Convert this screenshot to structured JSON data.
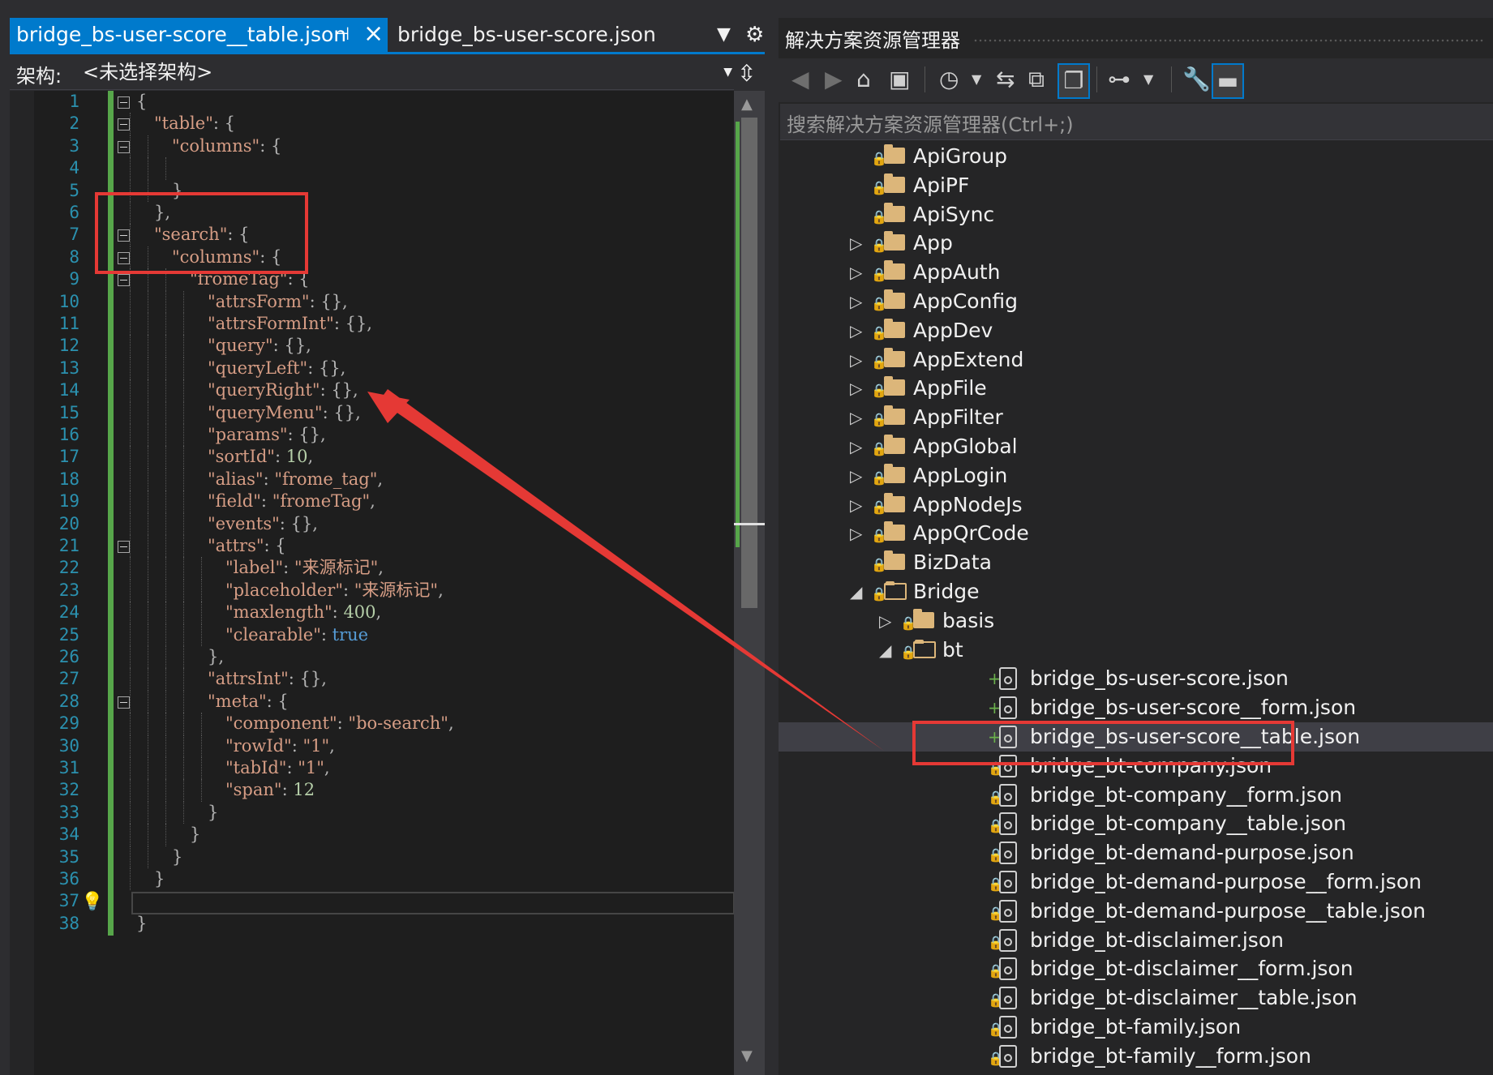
{
  "editor": {
    "tabs": [
      {
        "label": "bridge_bs-user-score__table.json",
        "active": true
      },
      {
        "label": "bridge_bs-user-score.json",
        "active": false
      }
    ],
    "schema_label": "架构:",
    "schema_value": "<未选择架构>",
    "lines": [
      {
        "n": "1",
        "html": "<span class='p'>{</span>"
      },
      {
        "n": "2",
        "html": "<span class='k'>\"table\"</span><span class='p'>: {</span>"
      },
      {
        "n": "3",
        "html": "<span class='k'>\"columns\"</span><span class='p'>: {</span>"
      },
      {
        "n": "4",
        "html": ""
      },
      {
        "n": "5",
        "html": "<span class='p'>}</span>"
      },
      {
        "n": "6",
        "html": "<span class='p'>},</span>"
      },
      {
        "n": "7",
        "html": "<span class='k'>\"search\"</span><span class='p'>: {</span>"
      },
      {
        "n": "8",
        "html": "<span class='k'>\"columns\"</span><span class='p'>: {</span>"
      },
      {
        "n": "9",
        "html": "<span class='k'>\"fromeTag\"</span><span class='p'>: {</span>"
      },
      {
        "n": "10",
        "html": "<span class='k'>\"attrsForm\"</span><span class='p'>: {},</span>"
      },
      {
        "n": "11",
        "html": "<span class='k'>\"attrsFormInt\"</span><span class='p'>: {},</span>"
      },
      {
        "n": "12",
        "html": "<span class='k'>\"query\"</span><span class='p'>: {},</span>"
      },
      {
        "n": "13",
        "html": "<span class='k'>\"queryLeft\"</span><span class='p'>: {},</span>"
      },
      {
        "n": "14",
        "html": "<span class='k'>\"queryRight\"</span><span class='p'>: {},</span>"
      },
      {
        "n": "15",
        "html": "<span class='k'>\"queryMenu\"</span><span class='p'>: {},</span>"
      },
      {
        "n": "16",
        "html": "<span class='k'>\"params\"</span><span class='p'>: {},</span>"
      },
      {
        "n": "17",
        "html": "<span class='k'>\"sortId\"</span><span class='p'>: </span><span class='n'>10</span><span class='p'>,</span>"
      },
      {
        "n": "18",
        "html": "<span class='k'>\"alias\"</span><span class='p'>: </span><span class='s'>\"frome_tag\"</span><span class='p'>,</span>"
      },
      {
        "n": "19",
        "html": "<span class='k'>\"field\"</span><span class='p'>: </span><span class='s'>\"fromeTag\"</span><span class='p'>,</span>"
      },
      {
        "n": "20",
        "html": "<span class='k'>\"events\"</span><span class='p'>: {},</span>"
      },
      {
        "n": "21",
        "html": "<span class='k'>\"attrs\"</span><span class='p'>: {</span>"
      },
      {
        "n": "22",
        "html": "<span class='k'>\"label\"</span><span class='p'>: </span><span class='s'>\"来源标记\"</span><span class='p'>,</span>"
      },
      {
        "n": "23",
        "html": "<span class='k'>\"placeholder\"</span><span class='p'>: </span><span class='s'>\"来源标记\"</span><span class='p'>,</span>"
      },
      {
        "n": "24",
        "html": "<span class='k'>\"maxlength\"</span><span class='p'>: </span><span class='n'>400</span><span class='p'>,</span>"
      },
      {
        "n": "25",
        "html": "<span class='k'>\"clearable\"</span><span class='p'>: </span><span class='b'>true</span>"
      },
      {
        "n": "26",
        "html": "<span class='p'>},</span>"
      },
      {
        "n": "27",
        "html": "<span class='k'>\"attrsInt\"</span><span class='p'>: {},</span>"
      },
      {
        "n": "28",
        "html": "<span class='k'>\"meta\"</span><span class='p'>: {</span>"
      },
      {
        "n": "29",
        "html": "<span class='k'>\"component\"</span><span class='p'>: </span><span class='s'>\"bo-search\"</span><span class='p'>,</span>"
      },
      {
        "n": "30",
        "html": "<span class='k'>\"rowId\"</span><span class='p'>: </span><span class='s'>\"1\"</span><span class='p'>,</span>"
      },
      {
        "n": "31",
        "html": "<span class='k'>\"tabId\"</span><span class='p'>: </span><span class='s'>\"1\"</span><span class='p'>,</span>"
      },
      {
        "n": "32",
        "html": "<span class='k'>\"span\"</span><span class='p'>: </span><span class='n'>12</span>"
      },
      {
        "n": "33",
        "html": "<span class='p'>}</span>"
      },
      {
        "n": "34",
        "html": "<span class='p'>}</span>"
      },
      {
        "n": "35",
        "html": "<span class='p'>}</span>"
      },
      {
        "n": "36",
        "html": "<span class='p'>}</span>"
      },
      {
        "n": "37",
        "html": ""
      },
      {
        "n": "38",
        "html": "<span class='p'>}</span>"
      }
    ]
  },
  "solution_explorer": {
    "title": "解决方案资源管理器",
    "search_placeholder": "搜索解决方案资源管理器(Ctrl+;)",
    "items": [
      {
        "label": "ApiGroup",
        "kind": "folder",
        "depth": 0,
        "expander": "none",
        "status": "lock"
      },
      {
        "label": "ApiPF",
        "kind": "folder",
        "depth": 0,
        "expander": "none",
        "status": "lock"
      },
      {
        "label": "ApiSync",
        "kind": "folder",
        "depth": 0,
        "expander": "none",
        "status": "lock"
      },
      {
        "label": "App",
        "kind": "folder",
        "depth": 0,
        "expander": "collapsed",
        "status": "lock"
      },
      {
        "label": "AppAuth",
        "kind": "folder",
        "depth": 0,
        "expander": "collapsed",
        "status": "lock"
      },
      {
        "label": "AppConfig",
        "kind": "folder",
        "depth": 0,
        "expander": "collapsed",
        "status": "lock"
      },
      {
        "label": "AppDev",
        "kind": "folder",
        "depth": 0,
        "expander": "collapsed",
        "status": "lock"
      },
      {
        "label": "AppExtend",
        "kind": "folder",
        "depth": 0,
        "expander": "collapsed",
        "status": "lock"
      },
      {
        "label": "AppFile",
        "kind": "folder",
        "depth": 0,
        "expander": "collapsed",
        "status": "lock"
      },
      {
        "label": "AppFilter",
        "kind": "folder",
        "depth": 0,
        "expander": "collapsed",
        "status": "lock"
      },
      {
        "label": "AppGlobal",
        "kind": "folder",
        "depth": 0,
        "expander": "collapsed",
        "status": "lock"
      },
      {
        "label": "AppLogin",
        "kind": "folder",
        "depth": 0,
        "expander": "collapsed",
        "status": "lock"
      },
      {
        "label": "AppNodeJs",
        "kind": "folder",
        "depth": 0,
        "expander": "collapsed",
        "status": "lock"
      },
      {
        "label": "AppQrCode",
        "kind": "folder",
        "depth": 0,
        "expander": "collapsed",
        "status": "lock"
      },
      {
        "label": "BizData",
        "kind": "folder",
        "depth": 0,
        "expander": "none",
        "status": "lock"
      },
      {
        "label": "Bridge",
        "kind": "folder-open",
        "depth": 0,
        "expander": "expanded",
        "status": "lock"
      },
      {
        "label": "basis",
        "kind": "folder",
        "depth": 1,
        "expander": "collapsed",
        "status": "lock"
      },
      {
        "label": "bt",
        "kind": "folder-open",
        "depth": 1,
        "expander": "expanded",
        "status": "lock"
      },
      {
        "label": "bridge_bs-user-score.json",
        "kind": "file",
        "depth": 2,
        "expander": "none",
        "status": "plus"
      },
      {
        "label": "bridge_bs-user-score__form.json",
        "kind": "file",
        "depth": 2,
        "expander": "none",
        "status": "plus"
      },
      {
        "label": "bridge_bs-user-score__table.json",
        "kind": "file",
        "depth": 2,
        "expander": "none",
        "status": "plus",
        "selected": true
      },
      {
        "label": "bridge_bt-company.json",
        "kind": "file",
        "depth": 2,
        "expander": "none",
        "status": "lock"
      },
      {
        "label": "bridge_bt-company__form.json",
        "kind": "file",
        "depth": 2,
        "expander": "none",
        "status": "lock"
      },
      {
        "label": "bridge_bt-company__table.json",
        "kind": "file",
        "depth": 2,
        "expander": "none",
        "status": "lock"
      },
      {
        "label": "bridge_bt-demand-purpose.json",
        "kind": "file",
        "depth": 2,
        "expander": "none",
        "status": "lock"
      },
      {
        "label": "bridge_bt-demand-purpose__form.json",
        "kind": "file",
        "depth": 2,
        "expander": "none",
        "status": "lock"
      },
      {
        "label": "bridge_bt-demand-purpose__table.json",
        "kind": "file",
        "depth": 2,
        "expander": "none",
        "status": "lock"
      },
      {
        "label": "bridge_bt-disclaimer.json",
        "kind": "file",
        "depth": 2,
        "expander": "none",
        "status": "lock"
      },
      {
        "label": "bridge_bt-disclaimer__form.json",
        "kind": "file",
        "depth": 2,
        "expander": "none",
        "status": "lock"
      },
      {
        "label": "bridge_bt-disclaimer__table.json",
        "kind": "file",
        "depth": 2,
        "expander": "none",
        "status": "lock"
      },
      {
        "label": "bridge_bt-family.json",
        "kind": "file",
        "depth": 2,
        "expander": "none",
        "status": "lock"
      },
      {
        "label": "bridge_bt-family__form.json",
        "kind": "file",
        "depth": 2,
        "expander": "none",
        "status": "lock"
      }
    ]
  },
  "colors": {
    "accent": "#007acc",
    "annotation": "#e53935",
    "editor_bg": "#1e1e1e",
    "panel_bg": "#252526"
  }
}
